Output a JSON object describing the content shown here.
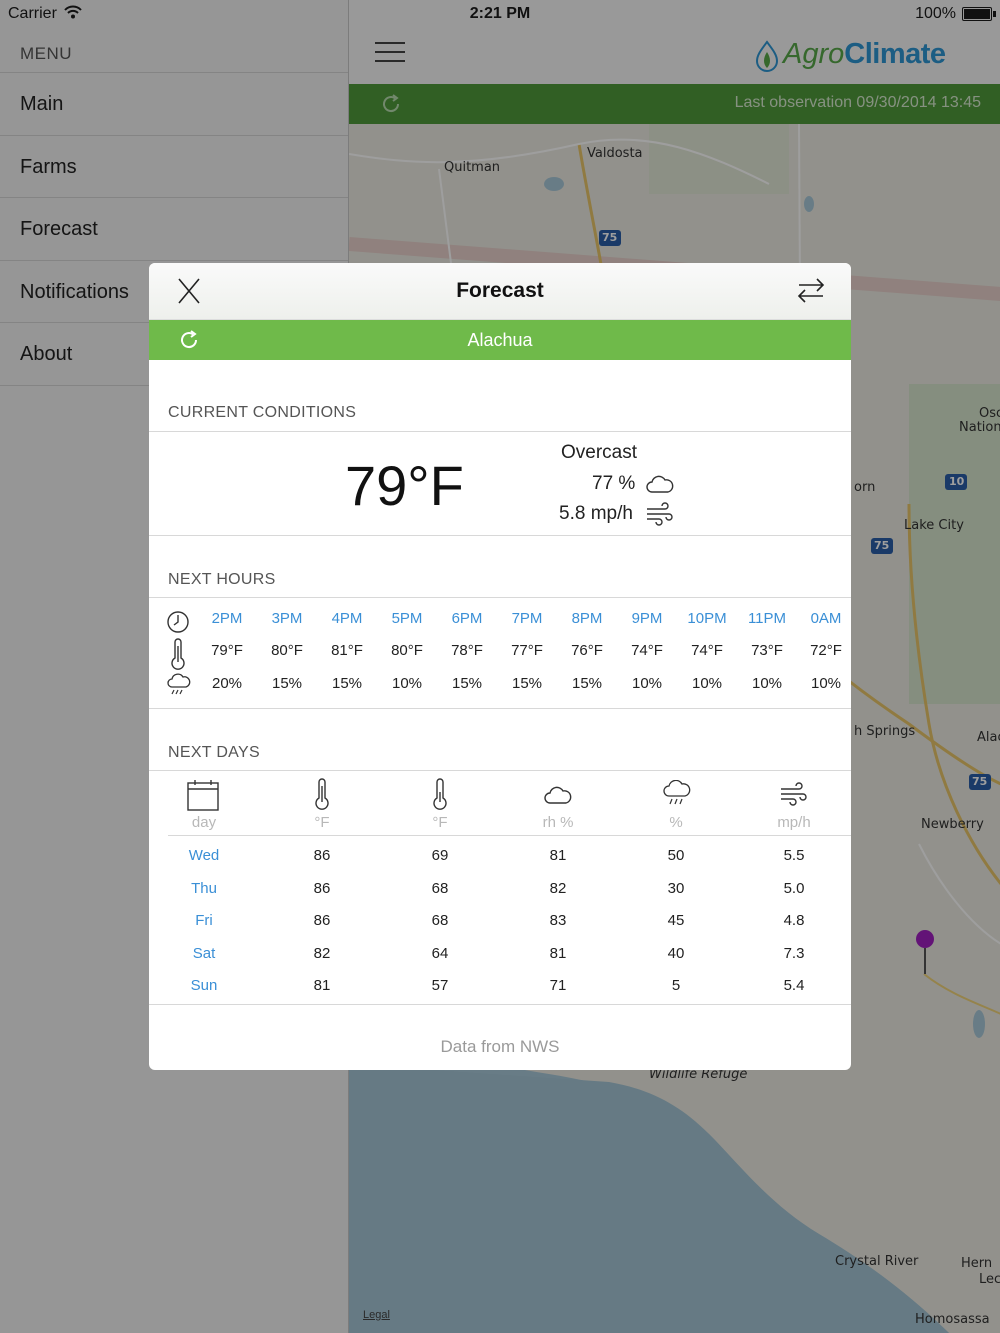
{
  "status_bar": {
    "carrier": "Carrier",
    "time": "2:21 PM",
    "battery": "100%"
  },
  "menu": {
    "title": "MENU",
    "items": [
      "Main",
      "Farms",
      "Forecast",
      "Notifications",
      "About"
    ]
  },
  "main": {
    "logo_agro": "Agro",
    "logo_climate": "Climate",
    "last_observation": "Last observation 09/30/2014 13:45",
    "map_labels": [
      "Quitman",
      "Valdosta",
      "Lake City",
      "Osc",
      "Nation",
      "orn",
      "h Springs",
      "Alac",
      "Newberry",
      "Wildlife Refuge",
      "Crystal River",
      "Hern",
      "Lec",
      "Homosassa"
    ],
    "highway_shields": [
      "75",
      "10",
      "75",
      "75"
    ],
    "legal": "Legal"
  },
  "modal": {
    "title": "Forecast",
    "location": "Alachua",
    "current": {
      "section_title": "CURRENT CONDITIONS",
      "temperature": "79°F",
      "condition": "Overcast",
      "humidity": "77 %",
      "wind": "5.8 mp/h"
    },
    "hours": {
      "section_title": "NEXT HOURS",
      "times": [
        "2PM",
        "3PM",
        "4PM",
        "5PM",
        "6PM",
        "7PM",
        "8PM",
        "9PM",
        "10PM",
        "11PM",
        "0AM"
      ],
      "temps": [
        "79°F",
        "80°F",
        "81°F",
        "80°F",
        "78°F",
        "77°F",
        "76°F",
        "74°F",
        "74°F",
        "73°F",
        "72°F"
      ],
      "rain": [
        "20%",
        "15%",
        "15%",
        "10%",
        "15%",
        "15%",
        "15%",
        "10%",
        "10%",
        "10%",
        "10%"
      ]
    },
    "days": {
      "section_title": "NEXT DAYS",
      "units": [
        "day",
        "°F",
        "°F",
        "rh %",
        "%",
        "mp/h"
      ],
      "rows": [
        [
          "Wed",
          "86",
          "69",
          "81",
          "50",
          "5.5"
        ],
        [
          "Thu",
          "86",
          "68",
          "82",
          "30",
          "5.0"
        ],
        [
          "Fri",
          "86",
          "68",
          "83",
          "45",
          "4.8"
        ],
        [
          "Sat",
          "82",
          "64",
          "81",
          "40",
          "7.3"
        ],
        [
          "Sun",
          "81",
          "57",
          "71",
          "5",
          "5.4"
        ]
      ]
    },
    "footer": "Data from NWS"
  },
  "colors": {
    "green_bar": "#4f9a3a",
    "location_bar": "#6fba4a",
    "link_blue": "#3a8fd6",
    "logo_green": "#58a84a",
    "logo_blue": "#2e96d3"
  }
}
